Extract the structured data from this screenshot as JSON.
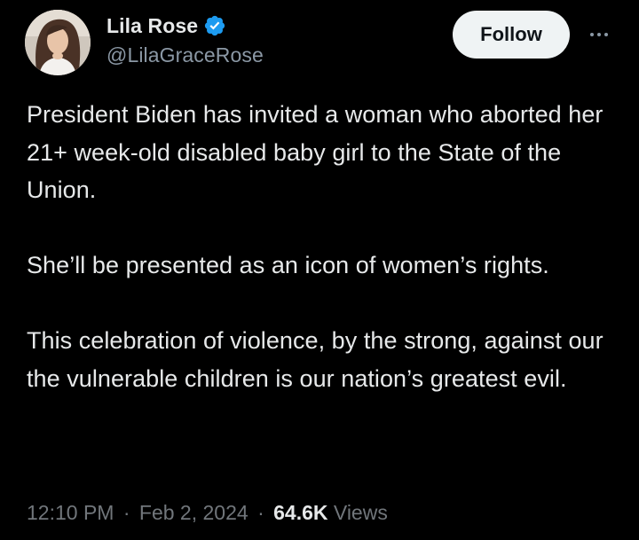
{
  "author": {
    "display_name": "Lila Rose",
    "handle": "@LilaGraceRose",
    "verified": true,
    "verified_color": "#1d9bf0"
  },
  "actions": {
    "follow_label": "Follow",
    "more_icon": "more-horizontal-icon"
  },
  "tweet": {
    "paragraphs": [
      "President Biden has invited a woman who aborted her 21+ week-old disabled baby girl to the State of the Union.",
      "She’ll be presented as an icon of women’s rights.",
      "This celebration of violence, by the strong, against our the vulnerable children is our nation’s greatest evil."
    ]
  },
  "meta": {
    "time": "12:10 PM",
    "separator": "·",
    "date": "Feb 2, 2024",
    "views_count": "64.6K",
    "views_label": "Views"
  },
  "colors": {
    "background": "#000000",
    "text_primary": "#e7e9ea",
    "text_secondary": "#71767b",
    "follow_button_bg": "#eff3f4",
    "follow_button_text": "#0f1419"
  }
}
